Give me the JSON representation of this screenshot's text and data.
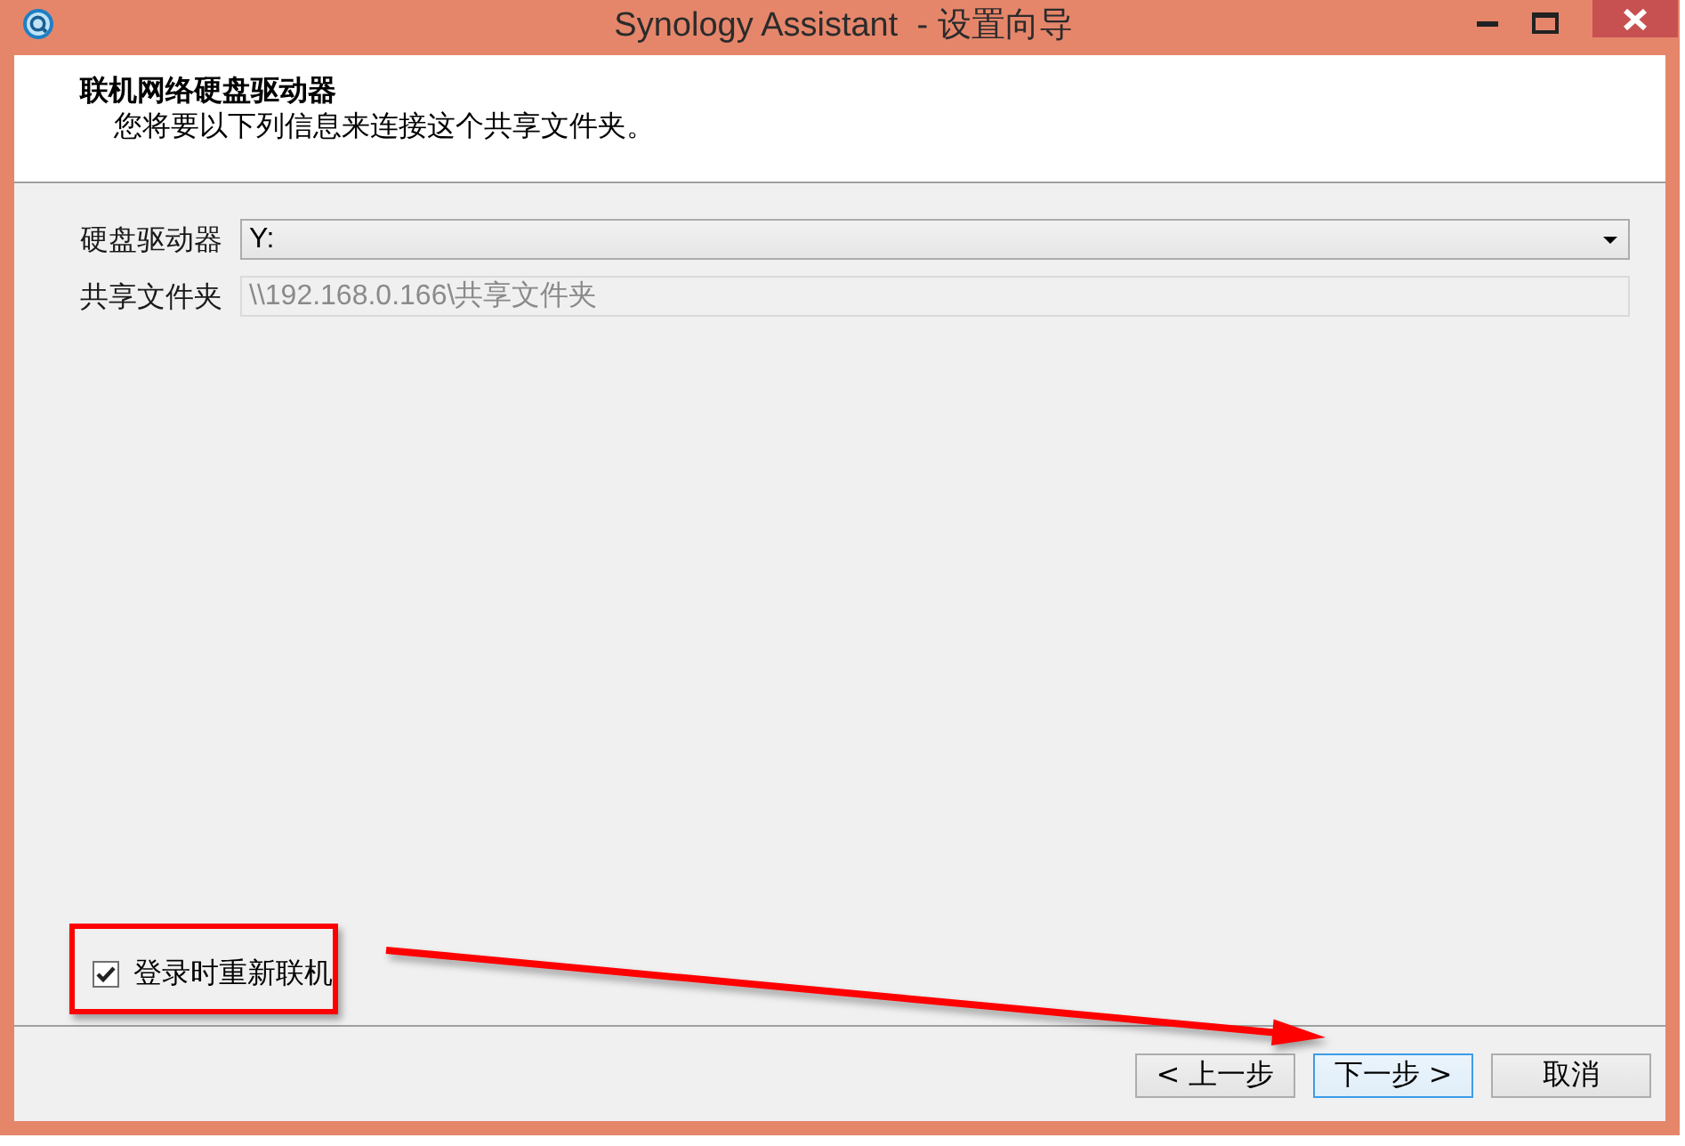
{
  "window": {
    "title": "Synology Assistant  - 设置向导"
  },
  "header": {
    "title": "联机网络硬盘驱动器",
    "subtitle": "您将要以下列信息来连接这个共享文件夹。"
  },
  "fields": [
    {
      "kind": "dropdown",
      "label": "硬盘驱动器",
      "value": "Y:",
      "disabled": false
    },
    {
      "kind": "text",
      "label": "共享文件夹",
      "value": "\\\\192.168.0.166\\共享文件夹",
      "disabled": true
    }
  ],
  "reconnect": {
    "label": "登录时重新联机",
    "checked": true
  },
  "buttons": [
    {
      "label": "< 上一步",
      "focused": false
    },
    {
      "label": "下一步 >",
      "focused": true
    },
    {
      "label": "取消",
      "focused": false
    }
  ]
}
